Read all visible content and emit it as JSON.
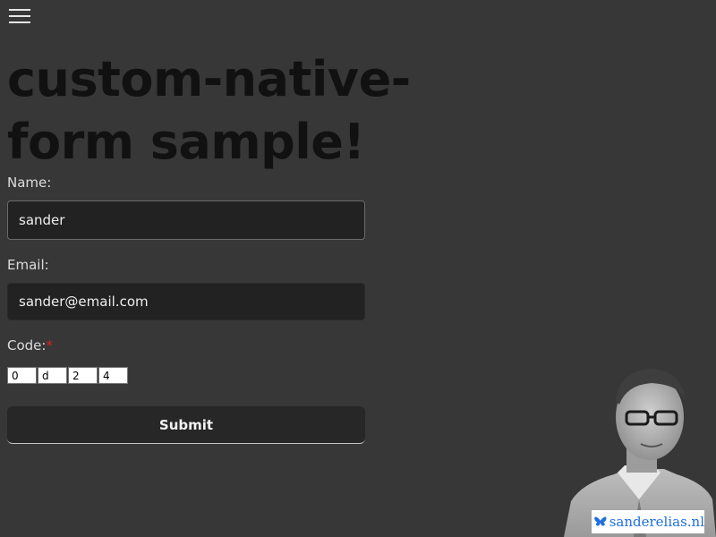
{
  "header": {
    "menu_icon": "hamburger-menu-icon"
  },
  "main": {
    "title": "custom-native-form sample!",
    "form": {
      "name_label": "Name:",
      "name_value": "sander",
      "email_label": "Email:",
      "email_value": "sander@email.com",
      "code_label": "Code:",
      "code_required_marker": "*",
      "code_values": [
        "0",
        "d",
        "2",
        "4"
      ],
      "submit_label": "Submit"
    }
  },
  "branding": {
    "site_name": "sanderelias.nl",
    "icon": "butterfly-icon",
    "accent_color": "#1f6fe0"
  },
  "colors": {
    "background": "#373737",
    "input_background": "#222222",
    "title_color": "#111111",
    "required_color": "#e02020"
  }
}
